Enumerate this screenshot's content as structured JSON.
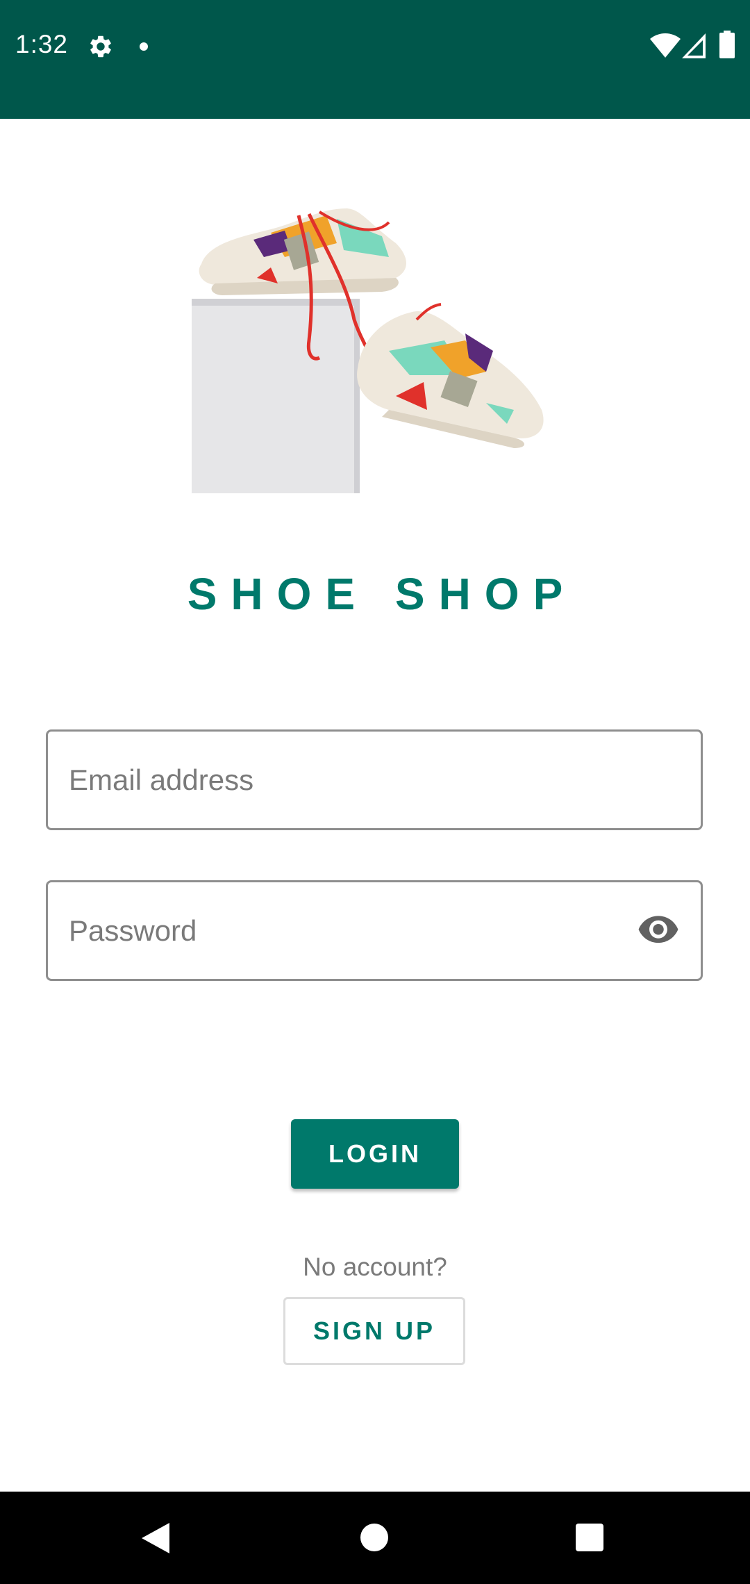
{
  "status_bar": {
    "time": "1:32",
    "icons": [
      "gear-icon",
      "notification-dot",
      "wifi-icon",
      "signal-icon",
      "battery-icon"
    ],
    "background": "#00574B"
  },
  "app": {
    "title": "SHOE SHOP",
    "accent_color": "#00796B"
  },
  "login_form": {
    "email_placeholder": "Email address",
    "email_value": "",
    "password_placeholder": "Password",
    "password_value": "",
    "password_toggle_icon": "eye-icon",
    "login_label": "LOGIN",
    "no_account_text": "No account?",
    "signup_label": "SIGN UP"
  },
  "nav_bar": {
    "buttons": [
      "back-icon",
      "home-icon",
      "recents-icon"
    ]
  }
}
